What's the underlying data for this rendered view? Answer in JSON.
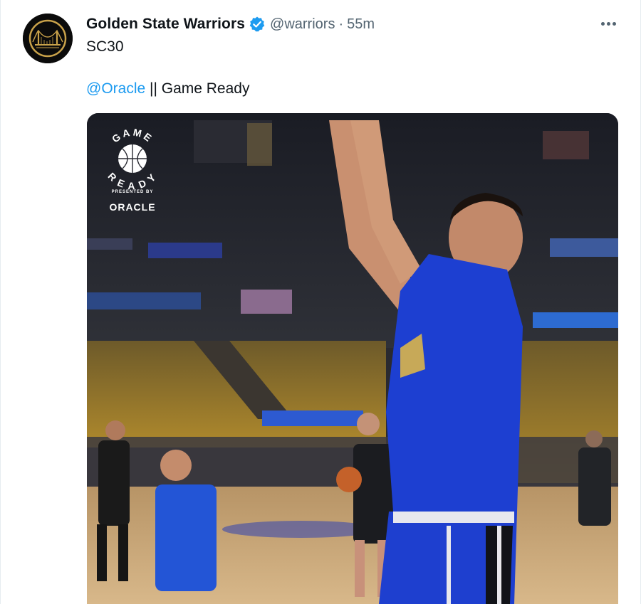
{
  "tweet": {
    "display_name": "Golden State Warriors",
    "handle": "@warriors",
    "separator": "·",
    "time": "55m",
    "text_line1": "SC30",
    "mention": "@Oracle",
    "text_line2_rest": " || Game Ready"
  },
  "media": {
    "badge_title": "GAME READY",
    "badge_presented": "PRESENTED BY",
    "badge_sponsor": "ORACLE"
  },
  "colors": {
    "link": "#1d9bf0",
    "verified": "#1d9bf0",
    "secondary_text": "#536471",
    "jersey_blue": "#1d3fd1",
    "court": "#c9a777"
  },
  "icons": {
    "verified": "verified-badge-icon",
    "more": "more-options-icon",
    "avatar": "warriors-logo-icon"
  }
}
